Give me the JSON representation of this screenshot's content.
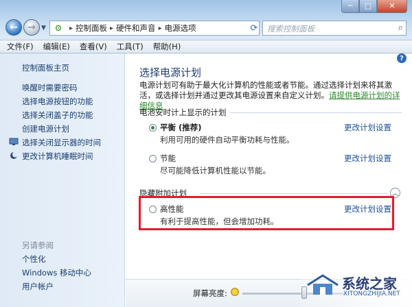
{
  "nav": {
    "breadcrumb": [
      "控制面板",
      "硬件和声音",
      "电源选项"
    ],
    "search_placeholder": "搜索控制面板"
  },
  "menu": [
    "文件(F)",
    "编辑(E)",
    "查看(V)",
    "工具(T)",
    "帮助(H)"
  ],
  "sidebar": {
    "home": "控制面板主页",
    "links": [
      "唤醒时需要密码",
      "选择电源按钮的功能",
      "选择关闭盖子的功能",
      "创建电源计划",
      "选择关闭显示器的时间",
      "更改计算机睡眠时间"
    ],
    "see_also_title": "另请参阅",
    "see_also": [
      "个性化",
      "Windows 移动中心",
      "用户帐户"
    ]
  },
  "main": {
    "title": "选择电源计划",
    "description": "电源计划可有助于最大化计算机的性能或者节能。通过选择计划来将其激活，或选择计划并通过更改其电源设置来自定义计划。",
    "description_link": "请提供电源计划的详细信息",
    "battery_section": "电池安时计上显示的计划",
    "hidden_section": "隐藏附加计划",
    "change_label": "更改计划设置",
    "plans": [
      {
        "name": "平衡 (推荐)",
        "desc": "利用可用的硬件自动平衡功耗与性能。",
        "checked": true
      },
      {
        "name": "节能",
        "desc": "尽可能降低计算机性能以节能。",
        "checked": false
      },
      {
        "name": "高性能",
        "desc": "有利于提高性能，但会增加功耗。",
        "checked": false
      }
    ],
    "brightness_label": "屏幕亮度:"
  },
  "watermark": {
    "title": "系统之家",
    "url": "XITONGZHIJIA.NET"
  },
  "colors": {
    "highlight": "#e8192c",
    "link": "#1c4f9c",
    "title": "#1e3c78"
  }
}
